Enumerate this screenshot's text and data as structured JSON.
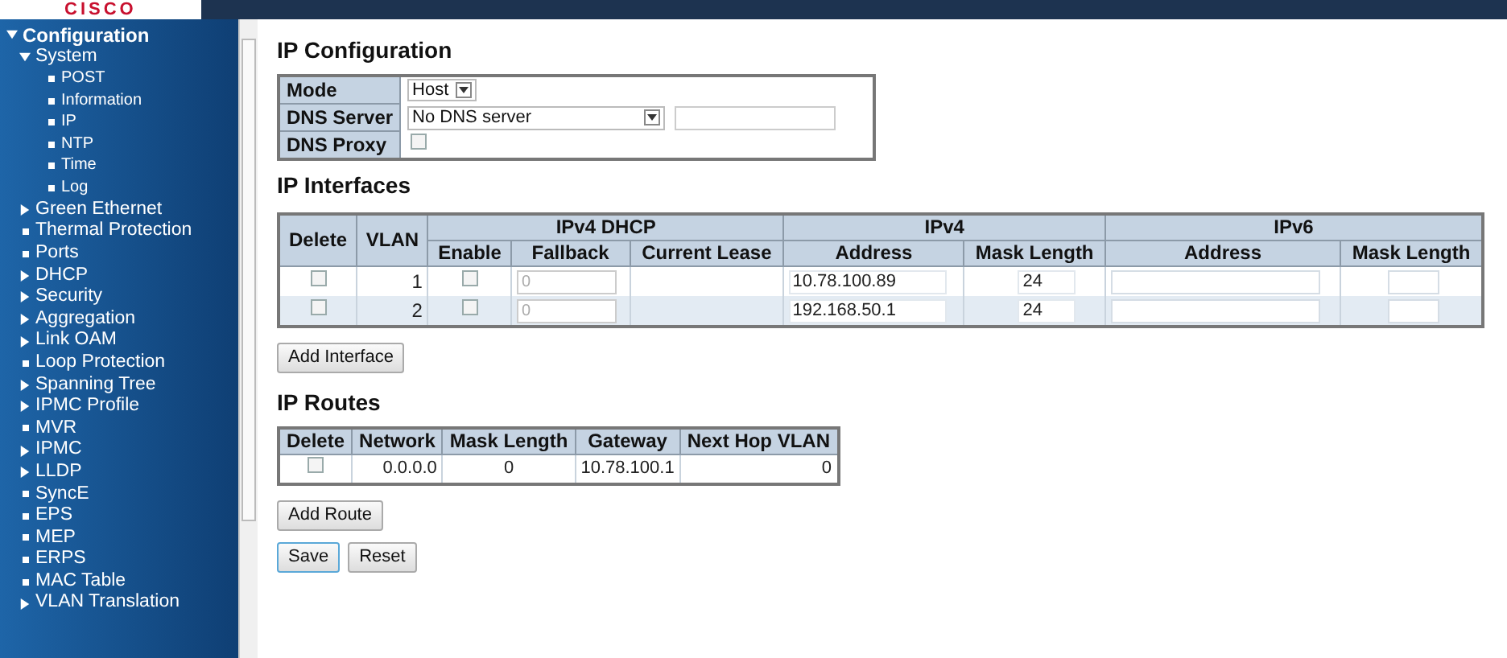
{
  "header": {
    "logo": "CISCO"
  },
  "sidebar": {
    "items": [
      {
        "label": "Configuration",
        "expanded": true,
        "children": [
          {
            "label": "System",
            "expanded": true,
            "children": [
              {
                "label": "POST"
              },
              {
                "label": "Information"
              },
              {
                "label": "IP"
              },
              {
                "label": "NTP"
              },
              {
                "label": "Time"
              },
              {
                "label": "Log"
              }
            ]
          },
          {
            "label": "Green Ethernet",
            "expanded": false
          },
          {
            "label": "Thermal Protection"
          },
          {
            "label": "Ports"
          },
          {
            "label": "DHCP",
            "expanded": false
          },
          {
            "label": "Security",
            "expanded": false
          },
          {
            "label": "Aggregation",
            "expanded": false
          },
          {
            "label": "Link OAM",
            "expanded": false
          },
          {
            "label": "Loop Protection"
          },
          {
            "label": "Spanning Tree",
            "expanded": false
          },
          {
            "label": "IPMC Profile",
            "expanded": false
          },
          {
            "label": "MVR"
          },
          {
            "label": "IPMC",
            "expanded": false
          },
          {
            "label": "LLDP",
            "expanded": false
          },
          {
            "label": "SyncE"
          },
          {
            "label": "EPS"
          },
          {
            "label": "MEP"
          },
          {
            "label": "ERPS"
          },
          {
            "label": "MAC Table"
          },
          {
            "label": "VLAN Translation",
            "expanded": false
          }
        ]
      }
    ]
  },
  "ip_configuration": {
    "title": "IP Configuration",
    "mode": {
      "label": "Mode",
      "value": "Host"
    },
    "dns_server": {
      "label": "DNS Server",
      "value": "No DNS server"
    },
    "dns_proxy": {
      "label": "DNS Proxy",
      "checked": false
    }
  },
  "ip_interfaces": {
    "title": "IP Interfaces",
    "groups": [
      "IPv4 DHCP",
      "IPv4",
      "IPv6"
    ],
    "columns": [
      "Delete",
      "VLAN",
      "Enable",
      "Fallback",
      "Current Lease",
      "Address",
      "Mask Length",
      "Address",
      "Mask Length"
    ],
    "rows": [
      {
        "delete": false,
        "vlan": "1",
        "enable": false,
        "fallback": "0",
        "current_lease": "",
        "ipv4_address": "10.78.100.89",
        "ipv4_mask": "24"
      },
      {
        "delete": false,
        "vlan": "2",
        "enable": false,
        "fallback": "0",
        "current_lease": "",
        "ipv4_address": "192.168.50.1",
        "ipv4_mask": "24"
      }
    ],
    "add_button": "Add Interface"
  },
  "ip_routes": {
    "title": "IP Routes",
    "columns": [
      "Delete",
      "Network",
      "Mask Length",
      "Gateway",
      "Next Hop VLAN"
    ],
    "rows": [
      {
        "delete": false,
        "network": "0.0.0.0",
        "mask_length": "0",
        "gateway": "10.78.100.1",
        "next_hop_vlan": "0"
      }
    ],
    "add_button": "Add Route"
  },
  "buttons": [
    "Save",
    "Reset"
  ]
}
